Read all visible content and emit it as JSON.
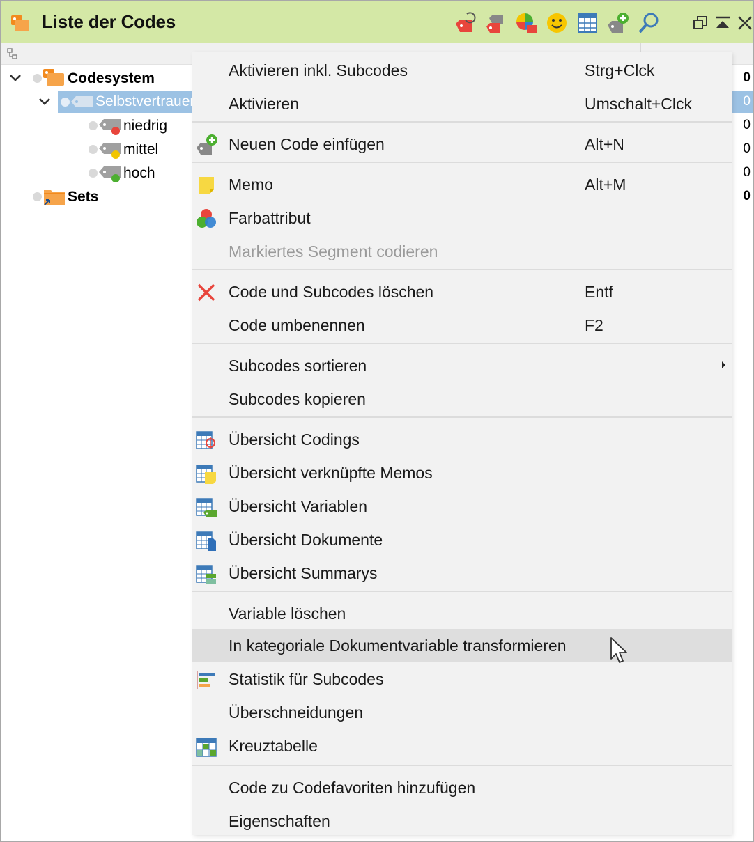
{
  "window": {
    "title": "Liste der Codes"
  },
  "toolbar": {
    "icons": [
      "activate-code-icon",
      "deactivate-codes-icon",
      "color-pie-icon",
      "smiley-icon",
      "table-icon",
      "new-code-icon",
      "search-icon"
    ],
    "window_controls": [
      "undock-icon",
      "collapse-icon",
      "close-icon"
    ]
  },
  "tree": {
    "root": "Codesystem",
    "selected": "Selbstvertrauen",
    "children": [
      {
        "label": "niedrig",
        "color": "#e8453c"
      },
      {
        "label": "mittel",
        "color": "#f2c500"
      },
      {
        "label": "hoch",
        "color": "#4caf30"
      }
    ],
    "sets": "Sets"
  },
  "counts": [
    "0",
    "0",
    "0",
    "0",
    "0",
    "0"
  ],
  "menu": {
    "items": [
      {
        "label": "Aktivieren inkl. Subcodes",
        "shortcut": "Strg+Clck"
      },
      {
        "label": "Aktivieren",
        "shortcut": "Umschalt+Clck"
      },
      {
        "label": "Neuen Code einfügen",
        "shortcut": "Alt+N",
        "icon": "new-code-icon"
      },
      {
        "label": "Memo",
        "shortcut": "Alt+M",
        "icon": "memo-icon"
      },
      {
        "label": "Farbattribut",
        "shortcut": "",
        "icon": "color-attribute-icon"
      },
      {
        "label": "Markiertes Segment codieren",
        "shortcut": "",
        "disabled": true
      },
      {
        "label": "Code und Subcodes löschen",
        "shortcut": "Entf",
        "icon": "delete-icon"
      },
      {
        "label": "Code umbenennen",
        "shortcut": "F2"
      },
      {
        "label": "Subcodes sortieren",
        "shortcut": "",
        "submenu": true
      },
      {
        "label": "Subcodes kopieren",
        "shortcut": ""
      },
      {
        "label": "Übersicht Codings",
        "shortcut": "",
        "icon": "overview-codings-icon"
      },
      {
        "label": "Übersicht verknüpfte Memos",
        "shortcut": "",
        "icon": "overview-memos-icon"
      },
      {
        "label": "Übersicht Variablen",
        "shortcut": "",
        "icon": "overview-variables-icon"
      },
      {
        "label": "Übersicht Dokumente",
        "shortcut": "",
        "icon": "overview-documents-icon"
      },
      {
        "label": "Übersicht Summarys",
        "shortcut": "",
        "icon": "overview-summaries-icon"
      },
      {
        "label": "Variable löschen",
        "shortcut": ""
      },
      {
        "label": "In kategoriale Dokumentvariable transformieren",
        "shortcut": "",
        "hover": true
      },
      {
        "label": "Statistik für Subcodes",
        "shortcut": "",
        "icon": "statistics-icon"
      },
      {
        "label": "Überschneidungen",
        "shortcut": ""
      },
      {
        "label": "Kreuztabelle",
        "shortcut": "",
        "icon": "crosstab-icon"
      },
      {
        "label": "Code zu Codefavoriten hinzufügen",
        "shortcut": ""
      },
      {
        "label": "Eigenschaften",
        "shortcut": ""
      }
    ]
  },
  "colors": {
    "titlebar": "#d4e8a6",
    "selection": "#9cc2e4",
    "menu_bg": "#f2f2f2",
    "hover": "#dedede"
  }
}
